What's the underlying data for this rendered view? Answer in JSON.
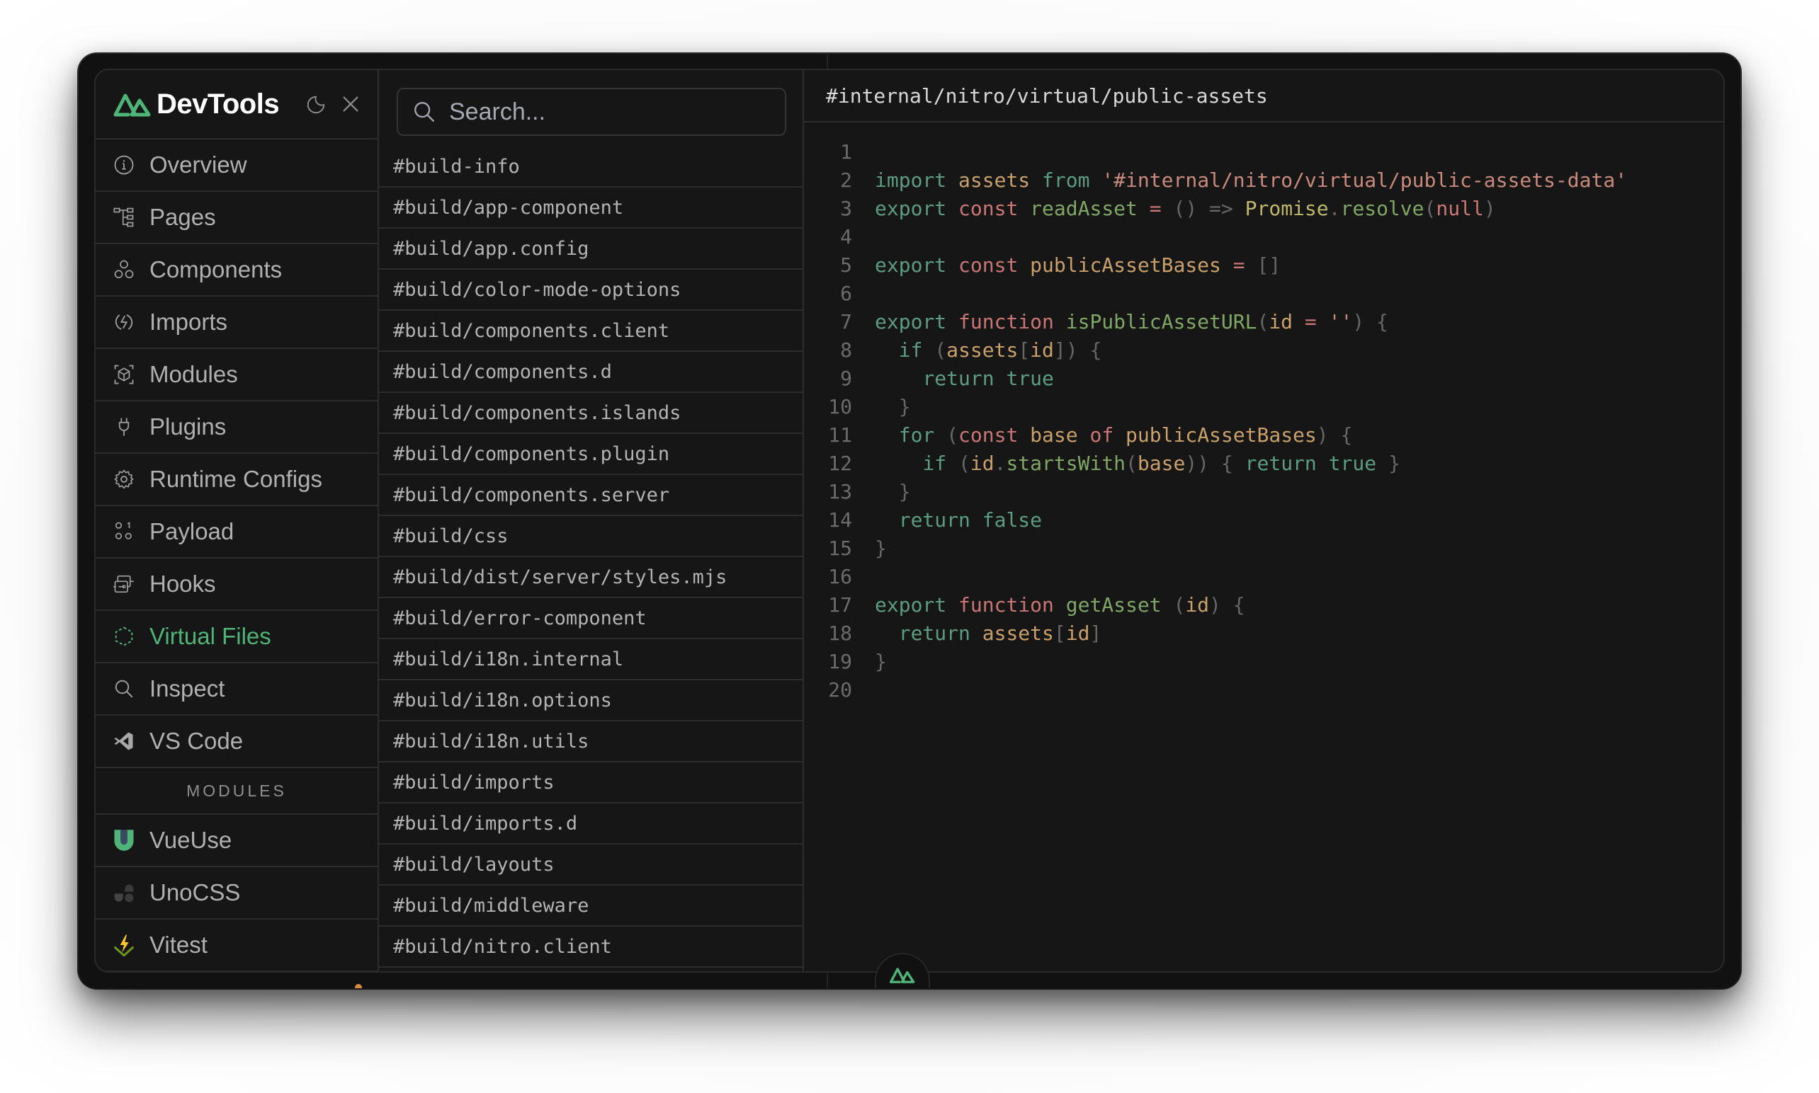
{
  "app": {
    "brand": "DevTools",
    "accent_color": "#4fb477",
    "theme_toggle_icon": "moon-icon",
    "close_icon": "close-icon"
  },
  "sidebar": {
    "items": [
      {
        "label": "Overview",
        "icon": "info-icon",
        "active": false
      },
      {
        "label": "Pages",
        "icon": "tree-icon",
        "active": false
      },
      {
        "label": "Components",
        "icon": "components-icon",
        "active": false
      },
      {
        "label": "Imports",
        "icon": "imports-icon",
        "active": false
      },
      {
        "label": "Modules",
        "icon": "modules-icon",
        "active": false
      },
      {
        "label": "Plugins",
        "icon": "plug-icon",
        "active": false
      },
      {
        "label": "Runtime Configs",
        "icon": "gear-icon",
        "active": false
      },
      {
        "label": "Payload",
        "icon": "payload-icon",
        "active": false
      },
      {
        "label": "Hooks",
        "icon": "hooks-icon",
        "active": false
      },
      {
        "label": "Virtual Files",
        "icon": "virtual-files-icon",
        "active": true
      },
      {
        "label": "Inspect",
        "icon": "search-icon",
        "active": false
      },
      {
        "label": "VS Code",
        "icon": "vscode-icon",
        "active": false
      }
    ],
    "section_label": "MODULES",
    "modules": [
      {
        "label": "VueUse",
        "icon": "vueuse-icon"
      },
      {
        "label": "UnoCSS",
        "icon": "unocss-icon"
      },
      {
        "label": "Vitest",
        "icon": "vitest-icon"
      }
    ]
  },
  "filelist": {
    "search_placeholder": "Search...",
    "search_value": "",
    "files": [
      "#build-info",
      "#build/app-component",
      "#build/app.config",
      "#build/color-mode-options",
      "#build/components.client",
      "#build/components.d",
      "#build/components.islands",
      "#build/components.plugin",
      "#build/components.server",
      "#build/css",
      "#build/dist/server/styles.mjs",
      "#build/error-component",
      "#build/i18n.internal",
      "#build/i18n.options",
      "#build/i18n.utils",
      "#build/imports",
      "#build/imports.d",
      "#build/layouts",
      "#build/middleware",
      "#build/nitro.client"
    ]
  },
  "code_panel": {
    "title": "#internal/nitro/virtual/public-assets",
    "lines": [
      [],
      [
        [
          "kw",
          "import"
        ],
        [
          "plain",
          " "
        ],
        [
          "id",
          "assets"
        ],
        [
          "plain",
          " "
        ],
        [
          "kw",
          "from"
        ],
        [
          "plain",
          " "
        ],
        [
          "str",
          "'#internal/nitro/virtual/public-assets-data'"
        ]
      ],
      [
        [
          "kw",
          "export"
        ],
        [
          "plain",
          " "
        ],
        [
          "kw2",
          "const"
        ],
        [
          "plain",
          " "
        ],
        [
          "fn",
          "readAsset"
        ],
        [
          "plain",
          " "
        ],
        [
          "op",
          "="
        ],
        [
          "plain",
          " "
        ],
        [
          "pun",
          "()"
        ],
        [
          "plain",
          " "
        ],
        [
          "pun",
          "=>"
        ],
        [
          "plain",
          " "
        ],
        [
          "cls",
          "Promise"
        ],
        [
          "pun",
          "."
        ],
        [
          "fn",
          "resolve"
        ],
        [
          "pun",
          "("
        ],
        [
          "nul",
          "null"
        ],
        [
          "pun",
          ")"
        ]
      ],
      [],
      [
        [
          "kw",
          "export"
        ],
        [
          "plain",
          " "
        ],
        [
          "kw2",
          "const"
        ],
        [
          "plain",
          " "
        ],
        [
          "id",
          "publicAssetBases"
        ],
        [
          "plain",
          " "
        ],
        [
          "op",
          "="
        ],
        [
          "plain",
          " "
        ],
        [
          "pun",
          "[]"
        ]
      ],
      [],
      [
        [
          "kw",
          "export"
        ],
        [
          "plain",
          " "
        ],
        [
          "kw2",
          "function"
        ],
        [
          "plain",
          " "
        ],
        [
          "fn",
          "isPublicAssetURL"
        ],
        [
          "pun",
          "("
        ],
        [
          "id",
          "id"
        ],
        [
          "plain",
          " "
        ],
        [
          "op",
          "="
        ],
        [
          "plain",
          " "
        ],
        [
          "str",
          "''"
        ],
        [
          "pun",
          ")"
        ],
        [
          "plain",
          " "
        ],
        [
          "pun",
          "{"
        ]
      ],
      [
        [
          "plain",
          "  "
        ],
        [
          "kw",
          "if"
        ],
        [
          "plain",
          " "
        ],
        [
          "pun",
          "("
        ],
        [
          "id",
          "assets"
        ],
        [
          "pun",
          "["
        ],
        [
          "id",
          "id"
        ],
        [
          "pun",
          "])"
        ],
        [
          "plain",
          " "
        ],
        [
          "pun",
          "{"
        ]
      ],
      [
        [
          "plain",
          "    "
        ],
        [
          "kw",
          "return"
        ],
        [
          "plain",
          " "
        ],
        [
          "kw",
          "true"
        ]
      ],
      [
        [
          "plain",
          "  "
        ],
        [
          "pun",
          "}"
        ]
      ],
      [
        [
          "plain",
          "  "
        ],
        [
          "kw",
          "for"
        ],
        [
          "plain",
          " "
        ],
        [
          "pun",
          "("
        ],
        [
          "kw2",
          "const"
        ],
        [
          "plain",
          " "
        ],
        [
          "id",
          "base"
        ],
        [
          "plain",
          " "
        ],
        [
          "kw2",
          "of"
        ],
        [
          "plain",
          " "
        ],
        [
          "id",
          "publicAssetBases"
        ],
        [
          "pun",
          ")"
        ],
        [
          "plain",
          " "
        ],
        [
          "pun",
          "{"
        ]
      ],
      [
        [
          "plain",
          "    "
        ],
        [
          "kw",
          "if"
        ],
        [
          "plain",
          " "
        ],
        [
          "pun",
          "("
        ],
        [
          "id",
          "id"
        ],
        [
          "pun",
          "."
        ],
        [
          "fn",
          "startsWith"
        ],
        [
          "pun",
          "("
        ],
        [
          "id",
          "base"
        ],
        [
          "pun",
          "))"
        ],
        [
          "plain",
          " "
        ],
        [
          "pun",
          "{"
        ],
        [
          "plain",
          " "
        ],
        [
          "kw",
          "return"
        ],
        [
          "plain",
          " "
        ],
        [
          "kw",
          "true"
        ],
        [
          "plain",
          " "
        ],
        [
          "pun",
          "}"
        ]
      ],
      [
        [
          "plain",
          "  "
        ],
        [
          "pun",
          "}"
        ]
      ],
      [
        [
          "plain",
          "  "
        ],
        [
          "kw",
          "return"
        ],
        [
          "plain",
          " "
        ],
        [
          "kw",
          "false"
        ]
      ],
      [
        [
          "pun",
          "}"
        ]
      ],
      [],
      [
        [
          "kw",
          "export"
        ],
        [
          "plain",
          " "
        ],
        [
          "kw2",
          "function"
        ],
        [
          "plain",
          " "
        ],
        [
          "fn",
          "getAsset"
        ],
        [
          "plain",
          " "
        ],
        [
          "pun",
          "("
        ],
        [
          "id",
          "id"
        ],
        [
          "pun",
          ")"
        ],
        [
          "plain",
          " "
        ],
        [
          "pun",
          "{"
        ]
      ],
      [
        [
          "plain",
          "  "
        ],
        [
          "kw",
          "return"
        ],
        [
          "plain",
          " "
        ],
        [
          "id",
          "assets"
        ],
        [
          "pun",
          "["
        ],
        [
          "id",
          "id"
        ],
        [
          "pun",
          "]"
        ]
      ],
      [
        [
          "pun",
          "}"
        ]
      ],
      []
    ]
  },
  "floating_button": {
    "icon": "nuxt-logo-icon"
  }
}
